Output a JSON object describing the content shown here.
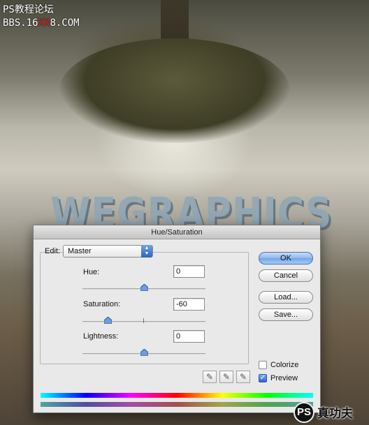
{
  "watermark": {
    "line1": "PS教程论坛",
    "line2_a": "BBS.16",
    "line2_b": "XX",
    "line2_c": "8.COM"
  },
  "background": {
    "brand_word": "WEGRAPHICS"
  },
  "corner_logo": {
    "mark": "PS",
    "text": "真功夫"
  },
  "dialog": {
    "title": "Hue/Saturation",
    "edit": {
      "label": "Edit:",
      "selected": "Master"
    },
    "hue": {
      "label": "Hue:",
      "value": "0",
      "level": 0
    },
    "saturation": {
      "label": "Saturation:",
      "value": "-60",
      "level": -60
    },
    "lightness": {
      "label": "Lightness:",
      "value": "0",
      "level": 0
    },
    "buttons": {
      "ok": "OK",
      "cancel": "Cancel",
      "load": "Load...",
      "save": "Save..."
    },
    "colorize": {
      "label": "Colorize",
      "checked": false
    },
    "preview": {
      "label": "Preview",
      "checked": true
    },
    "colors": {
      "default_button": "#8fb9ec",
      "checkbox_checked": "#2b65c9"
    }
  }
}
